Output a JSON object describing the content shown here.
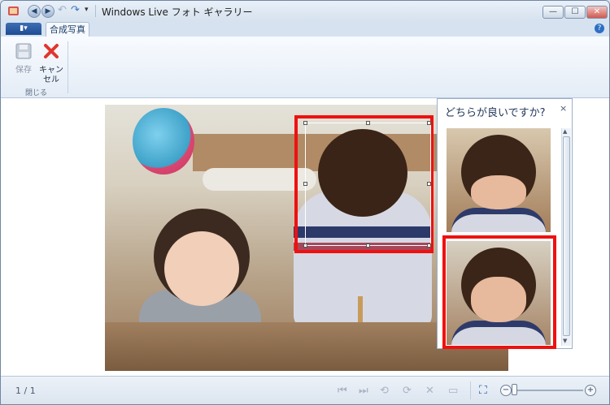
{
  "window": {
    "title": "Windows Live フォト ギャラリー",
    "controls": {
      "minimize": "—",
      "maximize": "☐",
      "close": "✕"
    }
  },
  "quick_access": {
    "back": "◀",
    "forward": "▶",
    "undo": "↶",
    "redo": "↷",
    "customize": "▾"
  },
  "ribbon": {
    "menu_button": "▮▾",
    "tab_label": "合成写真",
    "help": "?",
    "save_label": "保存",
    "cancel_label": "キャン\nセル",
    "group_label": "閉じる"
  },
  "panel": {
    "title": "どちらが良いですか?",
    "close": "×",
    "scroll_up": "▲",
    "scroll_down": "▼",
    "thumbnails": [
      "face-option-1",
      "face-option-2"
    ],
    "selected_index": 1
  },
  "status": {
    "page_count": "1 / 1",
    "zoom_minus": "−",
    "zoom_plus": "+",
    "icons": [
      "⏮",
      "⏭",
      "⟲",
      "⟳",
      "✕",
      "▭"
    ]
  }
}
